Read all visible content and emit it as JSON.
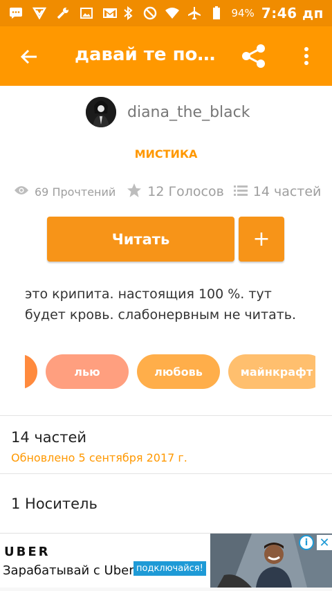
{
  "status_bar": {
    "battery": "94%",
    "time": "7:46 дп",
    "icons": [
      "message-icon",
      "vpn-icon",
      "wrench-icon",
      "image-icon",
      "gmail-icon",
      "bluetooth-icon",
      "no-sim-icon",
      "wifi-icon",
      "airplane-icon",
      "battery-icon"
    ]
  },
  "app_bar": {
    "title": "давай те пос...",
    "icons": [
      "back-arrow-icon",
      "share-icon",
      "more-vert-icon"
    ]
  },
  "story": {
    "author": "diana_the_black",
    "genre": "МИСТИКА",
    "reads": "69 Прочтений",
    "votes": "12 Голосов",
    "parts": "14 частей",
    "read_button": "Читать",
    "add_button": "+",
    "description": "это крипита. настоящия 100 %. тут будет кровь. слабонервным не читать.",
    "tags": [
      {
        "label": "",
        "color": "#ff8a3d"
      },
      {
        "label": "лью",
        "color": "#ff9f7f"
      },
      {
        "label": "любовь",
        "color": "#ffae4a"
      },
      {
        "label": "майнкрафт",
        "color": "#ffbf6e"
      }
    ]
  },
  "toc": {
    "parts_count": "14 частей",
    "updated": "Обновлено 5 сентября 2017 г.",
    "carrier": "1 Носитель"
  },
  "ad": {
    "brand": "UBER",
    "text": "Зарабатывай с Uber!",
    "cta": "подключайся!"
  },
  "colors": {
    "accent": "#ff9800",
    "status_bar": "#f08c00",
    "button": "#f79418"
  }
}
